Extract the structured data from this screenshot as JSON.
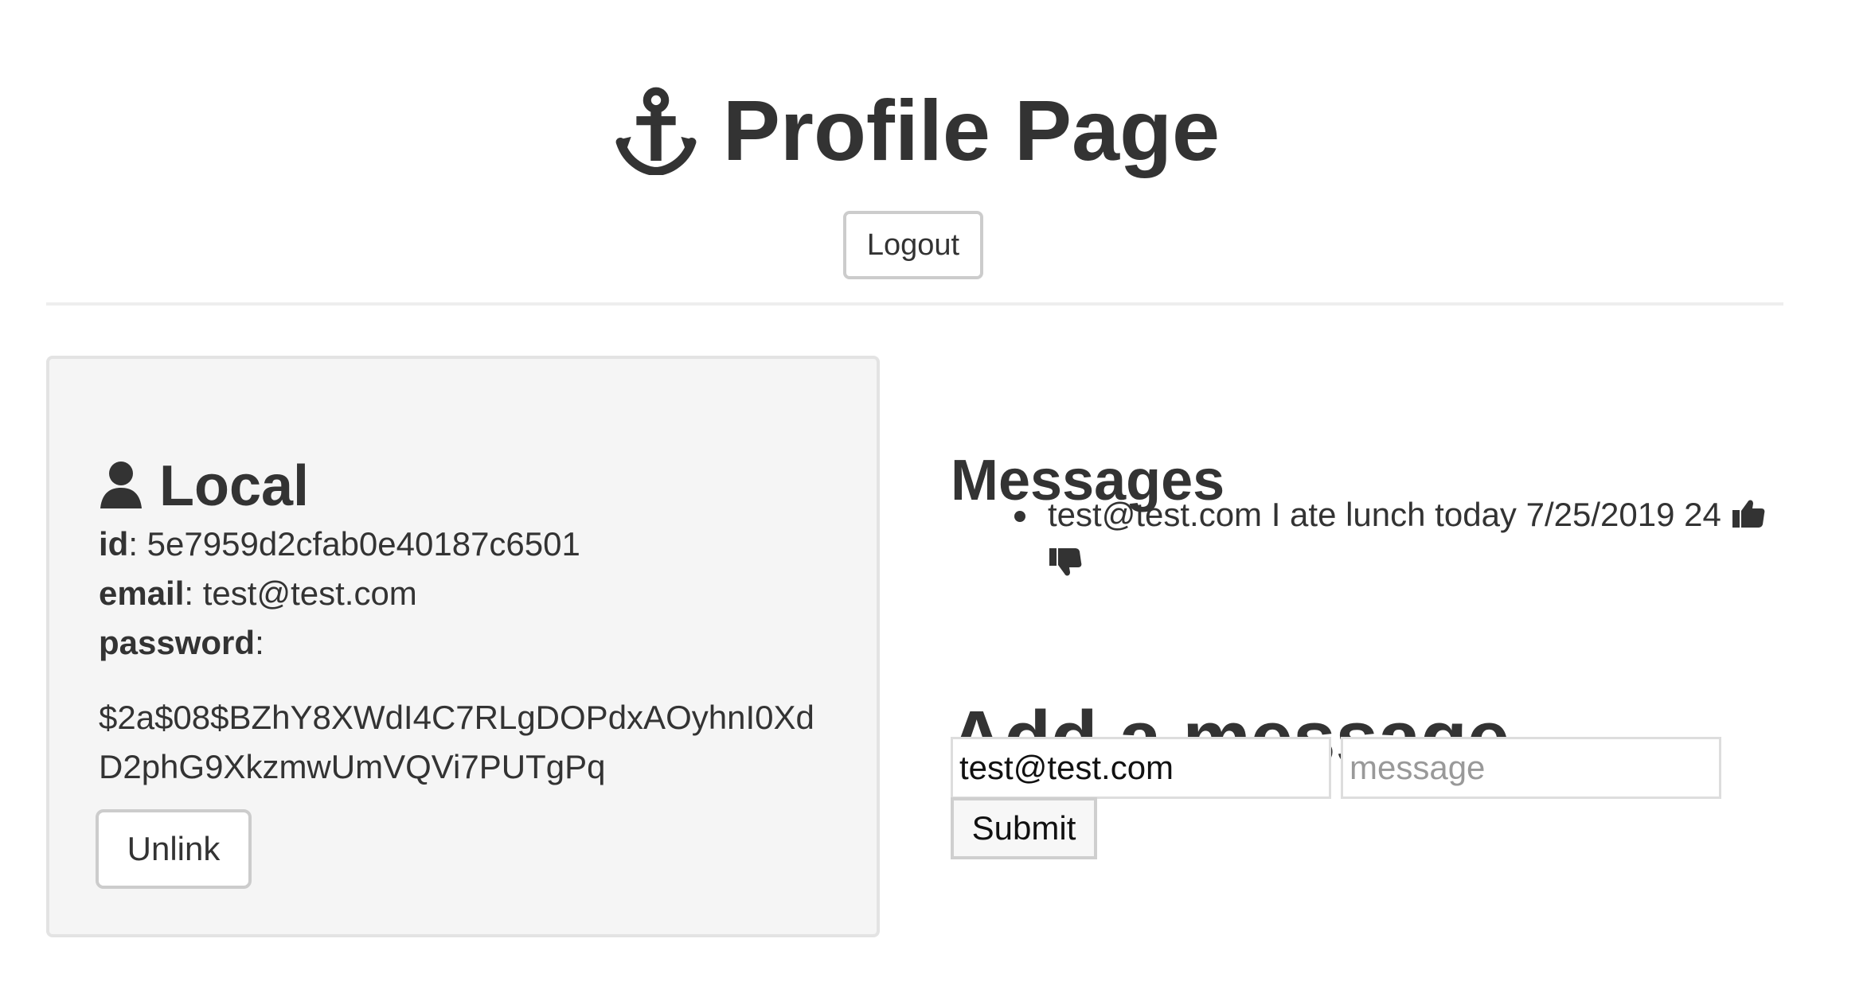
{
  "header": {
    "title": "Profile Page",
    "icon": "anchor-icon",
    "logout_label": "Logout"
  },
  "local_card": {
    "title": "Local",
    "icon": "user-icon",
    "id_label": "id",
    "id_value": "5e7959d2cfab0e40187c6501",
    "email_label": "email",
    "email_value": "test@test.com",
    "password_label": "password",
    "password_value": "$2a$08$BZhY8XWdI4C7RLgDOPdxAOyhnI0XdD2phG9XkzmwUmVQVi7PUTgPq",
    "unlink_label": "Unlink"
  },
  "messages": {
    "title": "Messages",
    "items": [
      {
        "text": "test@test.com I ate lunch today 7/25/2019 24",
        "like_icon": "thumbs-up-icon",
        "dislike_icon": "thumbs-down-icon"
      }
    ]
  },
  "add_message": {
    "title": "Add a message",
    "email_value": "test@test.com",
    "message_placeholder": "message",
    "submit_label": "Submit"
  },
  "colors": {
    "text": "#333333",
    "card_background": "#f5f5f5",
    "border": "#cccccc"
  }
}
